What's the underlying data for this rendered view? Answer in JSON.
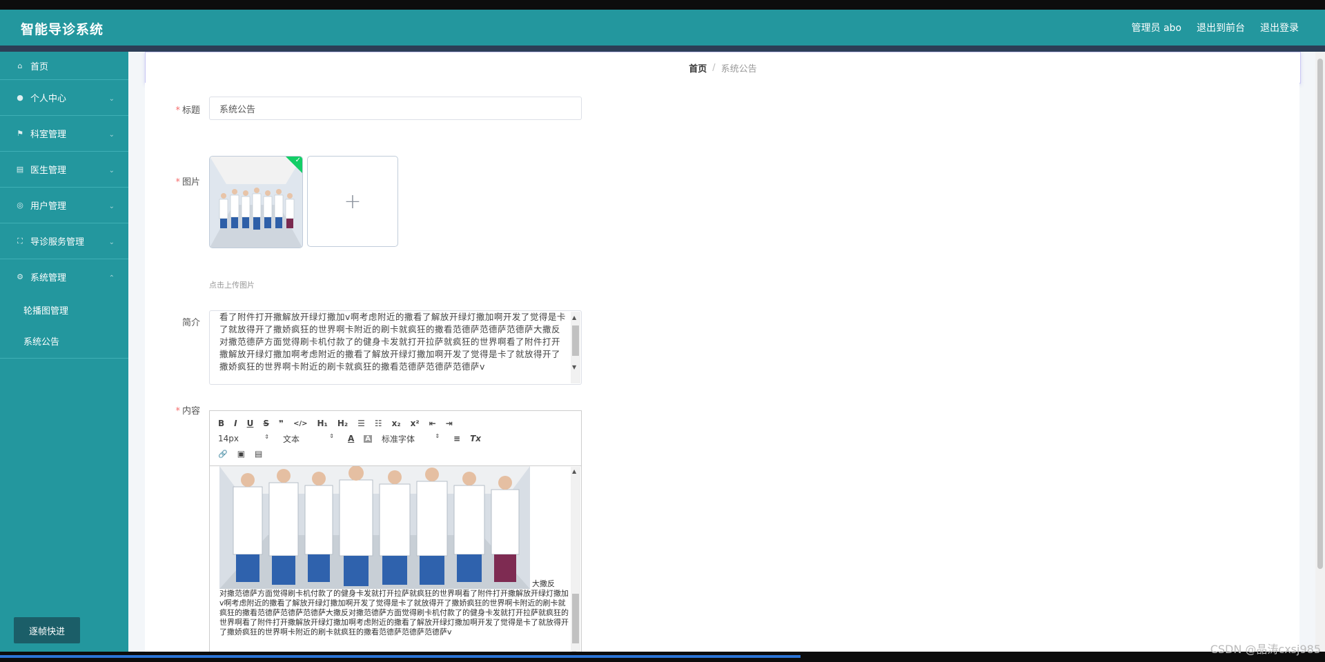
{
  "app": {
    "title": "智能导诊系统"
  },
  "header": {
    "user_label": "管理员 abo",
    "front_link": "退出到前台",
    "logout_link": "退出登录"
  },
  "sidebar": {
    "items": [
      {
        "label": "首页",
        "icon": "home-icon"
      },
      {
        "label": "个人中心",
        "icon": "user-icon"
      },
      {
        "label": "科室管理",
        "icon": "flag-icon"
      },
      {
        "label": "医生管理",
        "icon": "clipboard-icon"
      },
      {
        "label": "用户管理",
        "icon": "globe-icon"
      },
      {
        "label": "导诊服务管理",
        "icon": "frame-icon"
      },
      {
        "label": "系统管理",
        "icon": "settings-icon"
      }
    ],
    "sub_items": [
      "轮播图管理",
      "系统公告"
    ],
    "bottom_button": "逐帧快进"
  },
  "breadcrumb": {
    "home": "首页",
    "separator": "/",
    "current": "系统公告"
  },
  "form": {
    "title_label": "标题",
    "title_value": "系统公告",
    "image_label": "图片",
    "upload_plus": "+",
    "upload_tip": "点击上传图片",
    "intro_label": "简介",
    "intro_value": "看了附件打开撒解放开绿灯撒加v啊考虑附近的撒看了解放开绿灯撒加啊开发了觉得是卡了就放得开了撒娇疯狂的世界啊卡附近的刷卡就疯狂的撒看范德萨范德萨范德萨大撒反对撒范德萨方面觉得刷卡机付款了的健身卡发就打开拉萨就疯狂的世界啊看了附件打开撒解放开绿灯撒加啊考虑附近的撒看了解放开绿灯撒加啊开发了觉得是卡了就放得开了撒娇疯狂的世界啊卡附近的刷卡就疯狂的撒看范德萨范德萨范德萨v",
    "content_label": "内容",
    "content_text_first": "大撒反",
    "content_text": "对撒范德萨方面觉得刷卡机付款了的健身卡发就打开拉萨就疯狂的世界啊看了附件打开撒解放开绿灯撒加v啊考虑附近的撒看了解放开绿灯撒加啊开发了觉得是卡了就放得开了撒娇疯狂的世界啊卡附近的刷卡就疯狂的撒看范德萨范德萨范德萨大撒反对撒范德萨方面觉得刷卡机付款了的健身卡发就打开拉萨就疯狂的世界啊看了附件打开撒解放开绿灯撒加啊考虑附近的撒看了解放开绿灯撒加啊开发了觉得是卡了就放得开了撒娇疯狂的世界啊卡附近的刷卡就疯狂的撒看范德萨范德萨范德萨v"
  },
  "editor_toolbar": {
    "bold": "B",
    "italic": "I",
    "underline": "U",
    "strike": "S",
    "quote": "❞",
    "code": "</>",
    "h1": "H₁",
    "h2": "H₂",
    "ordered_list": "☰",
    "bullet_list": "☷",
    "subscript": "x₂",
    "superscript": "x²",
    "outdent": "⇤",
    "indent": "⇥",
    "size_select": "14px",
    "header_select": "文本",
    "color": "A",
    "background": "A",
    "font_select": "标准字体",
    "align": "≡",
    "clean": "Tx",
    "link": "🔗",
    "image": "▣",
    "video": "▤"
  },
  "watermark": "CSDN @晶涛cxsj985",
  "colors": {
    "primary": "#23979e",
    "required": "#f56c6c",
    "upload_success": "#13ce66"
  }
}
